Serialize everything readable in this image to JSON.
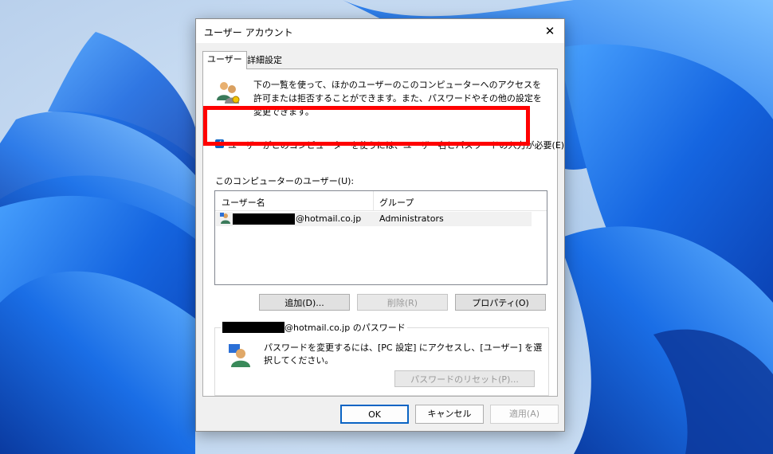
{
  "dialog": {
    "title": "ユーザー アカウント",
    "close_glyph": "✕"
  },
  "tabs": [
    {
      "label": "ユーザー",
      "active": true
    },
    {
      "label": "詳細設定",
      "active": false
    }
  ],
  "intro_text": "下の一覧を使って、ほかのユーザーのこのコンピューターへのアクセスを許可または拒否することができます。また、パスワードやその他の設定を変更できます。",
  "require_password": {
    "checked": true,
    "check_glyph": "✓",
    "label": "ユーザーがこのコンピューターを使うには、ユーザー名とパスワードの入力が必要(E)"
  },
  "users_list": {
    "label": "このコンピューターのユーザー(U):",
    "columns": [
      "ユーザー名",
      "グループ"
    ],
    "rows": [
      {
        "name": "@hotmail.co.jp",
        "group": "Administrators"
      }
    ]
  },
  "list_buttons": {
    "add": "追加(D)...",
    "remove": "削除(R)",
    "properties": "プロパティ(O)"
  },
  "password_group": {
    "title": "@hotmail.co.jp のパスワード",
    "text": "パスワードを変更するには、[PC 設定] にアクセスし、[ユーザー] を選択してください。",
    "reset_button": "パスワードのリセット(P)..."
  },
  "footer": {
    "ok": "OK",
    "cancel": "キャンセル",
    "apply": "適用(A)"
  },
  "colors": {
    "highlight": "#ff0000",
    "wallpaper_blue": "#1a6fe0",
    "checkbox": "#0a64c4"
  }
}
